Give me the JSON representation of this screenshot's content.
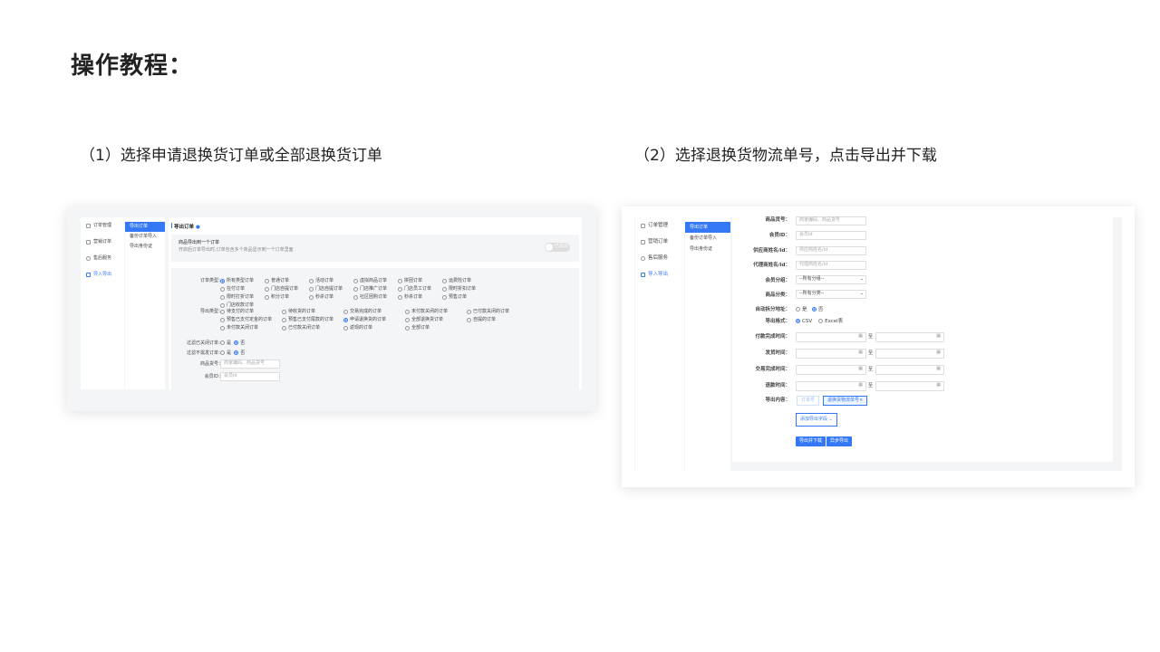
{
  "heading": "操作教程：",
  "step1": "（1）选择申请退换货订单或全部退换货订单",
  "step2": "（2）选择退换货物流单号，点击导出并下载",
  "shot1": {
    "nav": [
      "订单管理",
      "营销订单",
      "售后服务",
      "导入导出"
    ],
    "sub": [
      "导出订单",
      "备份订单导入",
      "导出身份证"
    ],
    "panel_title": "导出订单",
    "notice_title": "商品导出到一个订单",
    "notice_desc": "开启后订单导出时,订单包含多个商品显示到一个订单里面",
    "toggle_label": "已关闭",
    "order_type_label": "订单类型：",
    "order_types": [
      "所有类型订单",
      "普通订单",
      "活动订单",
      "虚拟商品订单",
      "拼团订单",
      "运费险订单",
      "在付订单",
      "门店自提订单",
      "门店自提订单",
      "门店推广订单",
      "门店员工订单",
      "限时折扣订单",
      "限时打折订单",
      "积分订单",
      "秒杀订单",
      "社区团购订单",
      "秒杀订单",
      "预售订单",
      "门店收款订单"
    ],
    "export_type_label": "导出类型：",
    "export_types": [
      "待支付的订单",
      "待收货的订单",
      "交易完成的订单",
      "未付款关闭的订单",
      "已付款关闭的订单",
      "预售已支付定金的订单",
      "预售已支付尾款的订单",
      "申请退换货的订单",
      "全部退换货订单",
      "自提的订单",
      "未付款关闭订单",
      "已付款关闭订单",
      "返现的订单",
      "全部订单"
    ],
    "filter1_label": "过滤已关闭订单：",
    "filter2_label": "过滤不需发订单：",
    "yes": "是",
    "no": "否",
    "product_code_label": "商品货号：",
    "product_code_placeholder": "商家编码、商品货号",
    "member_id_label": "会员ID：",
    "member_id_placeholder": "会员id"
  },
  "shot2": {
    "nav": [
      "订单管理",
      "营销订单",
      "售后服务",
      "导入导出"
    ],
    "sub": [
      "导出订单",
      "备份订单导入",
      "导出身份证"
    ],
    "product_label": "商品货号：",
    "product_placeholder": "商家编码、商品货号",
    "member_label": "会员ID：",
    "member_placeholder": "会员id",
    "supplier_label": "供应商姓名/id：",
    "supplier_placeholder": "供应商姓名/id",
    "agent_label": "代理商姓名/id：",
    "agent_placeholder": "代理商姓名/id",
    "group_label": "会员分组：",
    "group_value": "--所有分组--",
    "category_label": "商品分类：",
    "category_value": "--所有分类--",
    "auto_label": "自动拆分地址：",
    "yes": "是",
    "no": "否",
    "format_label": "导出格式：",
    "format_csv": "CSV",
    "format_xls": "Excel表",
    "pay_time_label": "付款完成时间：",
    "ship_time_label": "发货时间：",
    "finish_time_label": "交易完成时间：",
    "refund_time_label": "退款时间：",
    "to": "至",
    "content_label": "导出内容：",
    "content_tag1": "订单号",
    "content_tag2": "退换货物流单号×",
    "add_field": "添加导出字段",
    "export_download": "导出并下载",
    "async_export": "异步导出"
  }
}
